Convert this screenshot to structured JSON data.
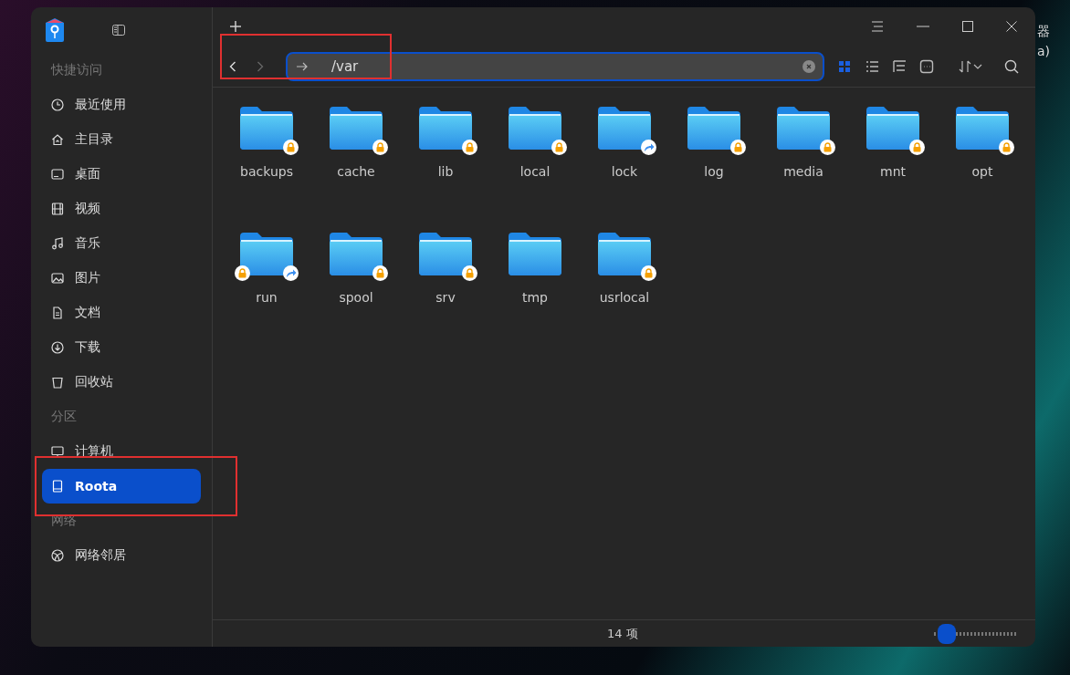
{
  "desktop": {
    "labels": [
      "器",
      "a)"
    ]
  },
  "sidebar": {
    "groups": [
      {
        "title": "快捷访问",
        "items": [
          {
            "label": "最近使用",
            "kind": "clock",
            "selected": false
          },
          {
            "label": "主目录",
            "kind": "home",
            "selected": false
          },
          {
            "label": "桌面",
            "kind": "desktop",
            "selected": false
          },
          {
            "label": "视频",
            "kind": "film",
            "selected": false
          },
          {
            "label": "音乐",
            "kind": "music",
            "selected": false
          },
          {
            "label": "图片",
            "kind": "image",
            "selected": false
          },
          {
            "label": "文档",
            "kind": "doc",
            "selected": false
          },
          {
            "label": "下载",
            "kind": "download",
            "selected": false
          },
          {
            "label": "回收站",
            "kind": "trash",
            "selected": false
          }
        ]
      },
      {
        "title": "分区",
        "items": [
          {
            "label": "计算机",
            "kind": "monitor",
            "selected": false
          },
          {
            "label": "Roota",
            "kind": "disk",
            "selected": true
          }
        ]
      },
      {
        "title": "网络",
        "items": [
          {
            "label": "网络邻居",
            "kind": "globe",
            "selected": false
          }
        ]
      }
    ]
  },
  "address": {
    "value": "/var"
  },
  "view_modes": [
    {
      "kind": "icons",
      "selected": true
    },
    {
      "kind": "list",
      "selected": false
    },
    {
      "kind": "tree",
      "selected": false
    },
    {
      "kind": "more",
      "selected": false
    }
  ],
  "folders": [
    {
      "name": "backups",
      "locked": true,
      "shortcut": false
    },
    {
      "name": "cache",
      "locked": true,
      "shortcut": false
    },
    {
      "name": "lib",
      "locked": true,
      "shortcut": false
    },
    {
      "name": "local",
      "locked": true,
      "shortcut": false
    },
    {
      "name": "lock",
      "locked": false,
      "shortcut": true
    },
    {
      "name": "log",
      "locked": true,
      "shortcut": false
    },
    {
      "name": "media",
      "locked": true,
      "shortcut": false
    },
    {
      "name": "mnt",
      "locked": true,
      "shortcut": false
    },
    {
      "name": "opt",
      "locked": true,
      "shortcut": false
    },
    {
      "name": "run",
      "locked": true,
      "shortcut": true
    },
    {
      "name": "spool",
      "locked": true,
      "shortcut": false
    },
    {
      "name": "srv",
      "locked": true,
      "shortcut": false
    },
    {
      "name": "tmp",
      "locked": false,
      "shortcut": false
    },
    {
      "name": "usrlocal",
      "locked": true,
      "shortcut": false
    }
  ],
  "status_bar": {
    "count": "14 项",
    "zoom": {
      "level": 0.05
    }
  }
}
